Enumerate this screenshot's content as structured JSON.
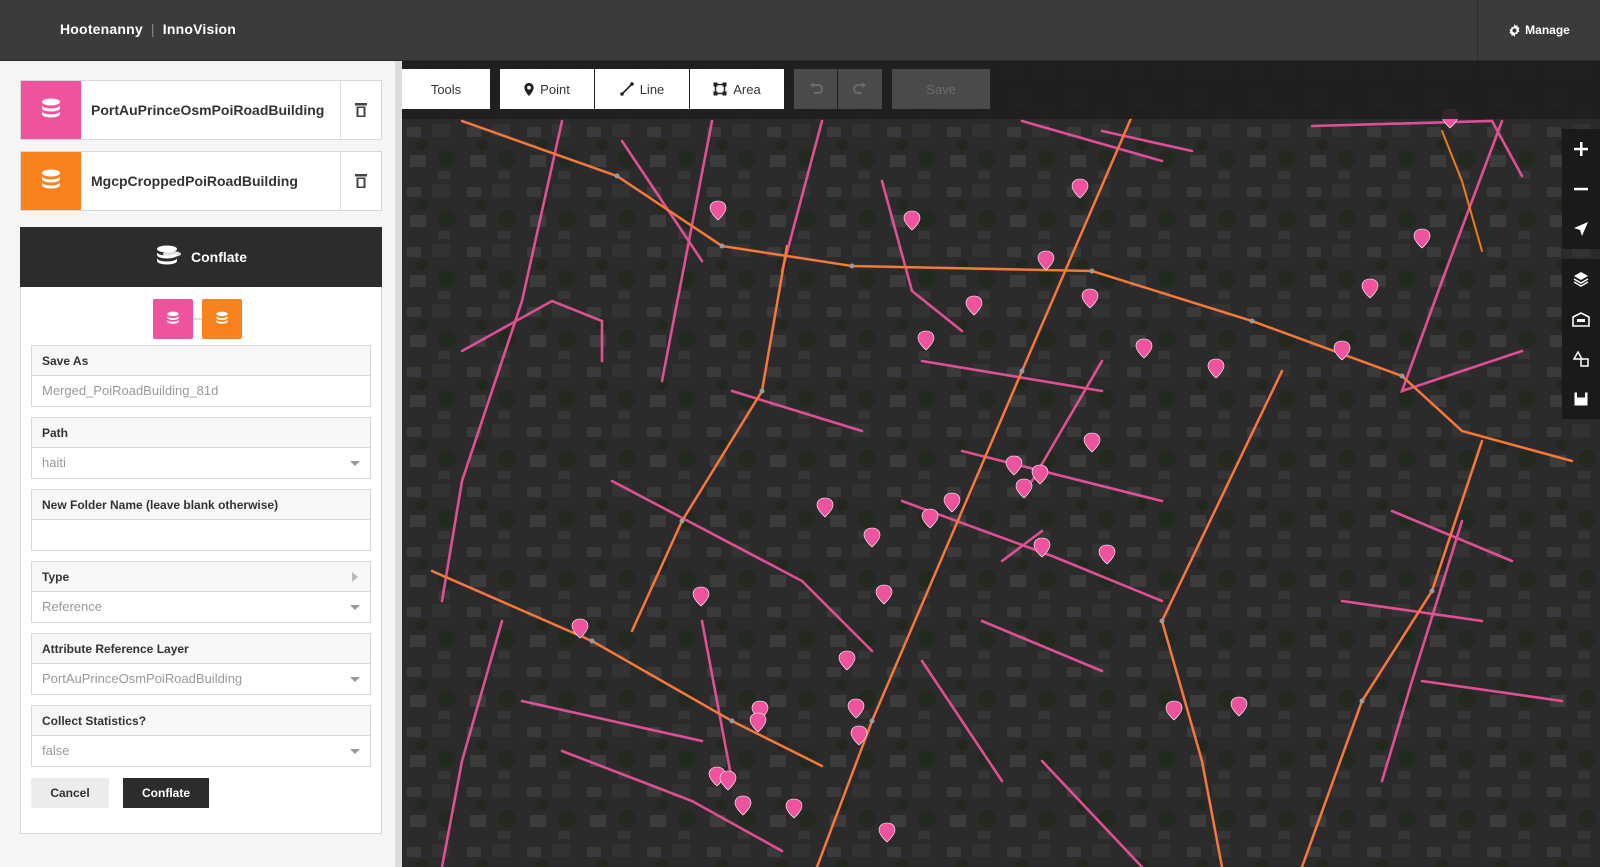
{
  "app": {
    "brand": "Hootenanny",
    "org": "InnoVision",
    "manage_label": "Manage"
  },
  "layers": [
    {
      "name": "PortAuPrinceOsmPoiRoadBuilding",
      "color": "#f0539e"
    },
    {
      "name": "MgcpCroppedPoiRoadBuilding",
      "color": "#f7821e"
    }
  ],
  "conflate": {
    "title": "Conflate",
    "fields": [
      {
        "label": "Save As",
        "value": "Merged_PoiRoadBuilding_81d"
      },
      {
        "label": "Path",
        "value": "haiti"
      },
      {
        "label": "New Folder Name (leave blank otherwise)",
        "value": ""
      },
      {
        "label": "Type",
        "value": "Reference"
      },
      {
        "label": "Attribute Reference Layer",
        "value": "PortAuPrinceOsmPoiRoadBuilding"
      },
      {
        "label": "Collect Statistics?",
        "value": "false"
      }
    ],
    "cancel_label": "Cancel",
    "submit_label": "Conflate"
  },
  "toolbar": {
    "tools": "Tools",
    "point": "Point",
    "line": "Line",
    "area": "Area",
    "save": "Save"
  },
  "colors": {
    "osm": "#f0539e",
    "mgcp": "#f7821e",
    "dark": "#2c2c2c"
  }
}
